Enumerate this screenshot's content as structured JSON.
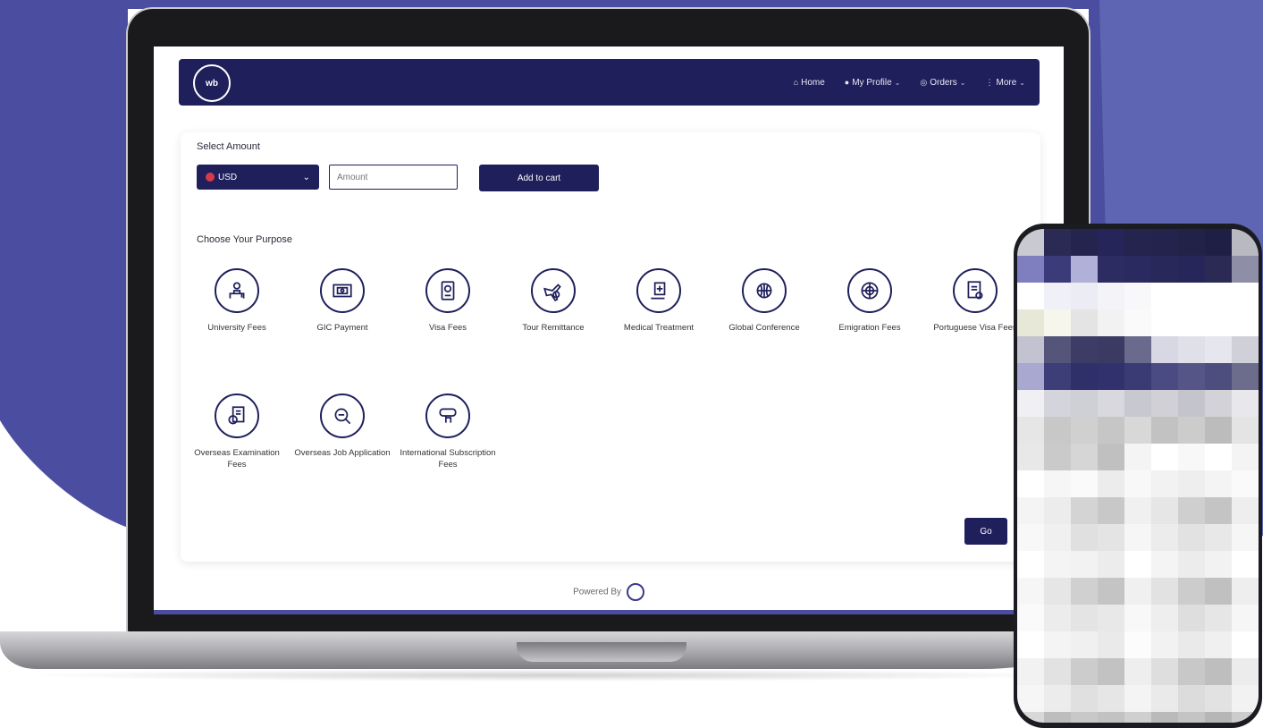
{
  "colors": {
    "brand_navy": "#1f1f5c",
    "background_purple": "#5b62b0",
    "background_blob": "#4b4ea0"
  },
  "navbar": {
    "logo_text": "wb",
    "items": [
      {
        "label": "Home",
        "icon": "home-icon"
      },
      {
        "label": "My Profile",
        "icon": "user-icon"
      },
      {
        "label": "Orders",
        "icon": "orders-icon"
      },
      {
        "label": "More",
        "icon": "more-icon"
      }
    ]
  },
  "form": {
    "select_amount_label": "Select Amount",
    "currency_value": "USD",
    "amount_placeholder": "Amount",
    "add_to_cart_label": "Add to cart",
    "purpose_label": "Choose Your Purpose",
    "go_label": "Go"
  },
  "purposes": [
    {
      "label": "University Fees",
      "icon": "university-icon"
    },
    {
      "label": "GIC Payment",
      "icon": "gic-payment-icon"
    },
    {
      "label": "Visa Fees",
      "icon": "passport-icon"
    },
    {
      "label": "Tour Remittance",
      "icon": "airplane-icon"
    },
    {
      "label": "Medical Treatment",
      "icon": "medical-icon"
    },
    {
      "label": "Global Conference",
      "icon": "globe-conference-icon"
    },
    {
      "label": "Emigration Fees",
      "icon": "globe-icon"
    },
    {
      "label": "Portuguese Visa Fees",
      "icon": "document-icon"
    },
    {
      "label": "Overseas Examination Fees",
      "icon": "exam-icon"
    },
    {
      "label": "Overseas Job Application",
      "icon": "job-search-icon"
    },
    {
      "label": "International Subscription Fees",
      "icon": "subscription-icon"
    }
  ],
  "footer": {
    "powered_by": "Powered By"
  }
}
